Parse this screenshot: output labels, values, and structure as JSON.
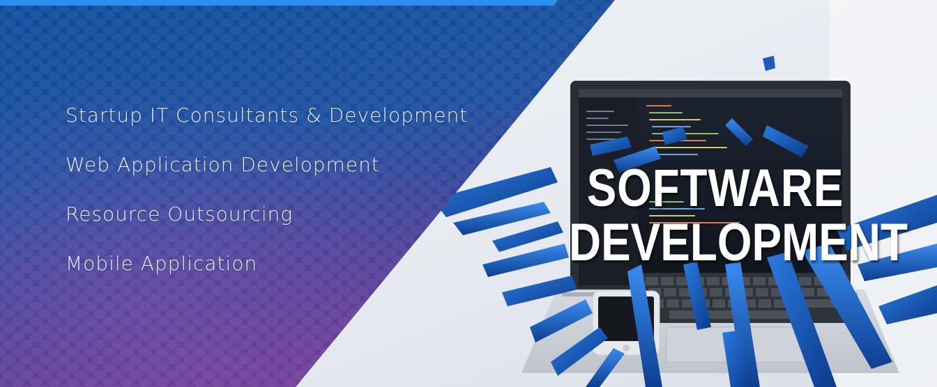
{
  "services": {
    "items": [
      "Startup IT Consultants & Development",
      "Web Application Development",
      "Resource Outsourcing",
      "Mobile Application"
    ]
  },
  "headline": {
    "line1": "SOFTWARE",
    "line2": "DEVELOPMENT"
  },
  "colors": {
    "panel_dark": "#0d3f8a",
    "panel_purple": "#5d3a92",
    "top_strip": "#2c8ff0",
    "accent_blue": "#1a63c7",
    "background": "#eef1f5"
  },
  "icons": {
    "laptop": "laptop-icon",
    "phone": "phone-icon"
  }
}
